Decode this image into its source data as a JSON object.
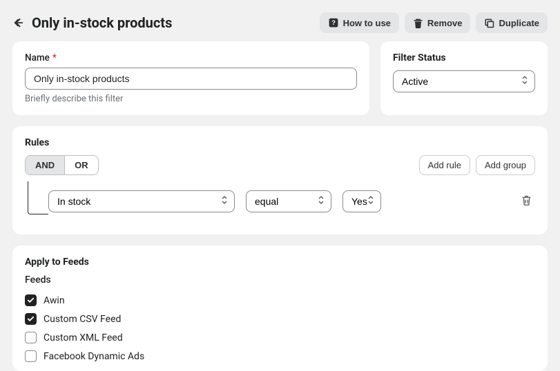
{
  "header": {
    "title": "Only in-stock products",
    "howToUse": "How to use",
    "remove": "Remove",
    "duplicate": "Duplicate"
  },
  "nameCard": {
    "label": "Name",
    "value": "Only in-stock products",
    "help": "Briefly describe this filter"
  },
  "statusCard": {
    "heading": "Filter Status",
    "value": "Active"
  },
  "rules": {
    "heading": "Rules",
    "and": "AND",
    "or": "OR",
    "addRule": "Add rule",
    "addGroup": "Add group",
    "row": {
      "field": "In stock",
      "op": "equal",
      "value": "Yes"
    }
  },
  "apply": {
    "heading": "Apply to Feeds",
    "feedsLabel": "Feeds",
    "items": [
      {
        "label": "Awin",
        "checked": true
      },
      {
        "label": "Custom CSV Feed",
        "checked": true
      },
      {
        "label": "Custom XML Feed",
        "checked": false
      },
      {
        "label": "Facebook Dynamic Ads",
        "checked": false
      }
    ]
  }
}
